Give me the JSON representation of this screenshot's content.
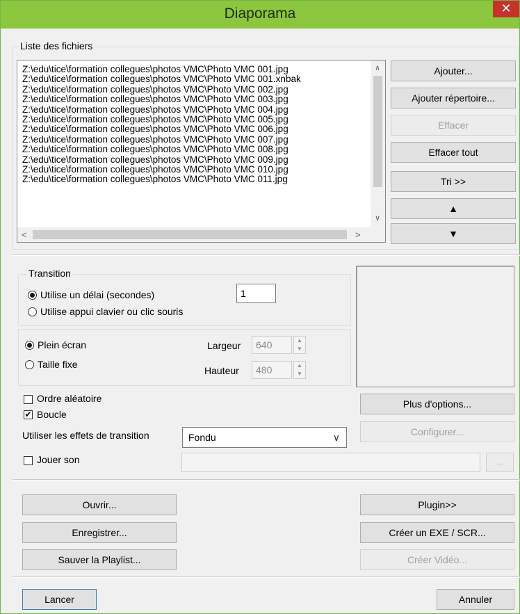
{
  "window": {
    "title": "Diaporama",
    "close_glyph": "✕"
  },
  "file_list": {
    "legend": "Liste des fichiers",
    "items": [
      "Z:\\edu\\tice\\formation collegues\\photos VMC\\Photo  VMC 001.jpg",
      "Z:\\edu\\tice\\formation collegues\\photos VMC\\Photo  VMC 001.xnbak",
      "Z:\\edu\\tice\\formation collegues\\photos VMC\\Photo  VMC 002.jpg",
      "Z:\\edu\\tice\\formation collegues\\photos VMC\\Photo  VMC 003.jpg",
      "Z:\\edu\\tice\\formation collegues\\photos VMC\\Photo  VMC 004.jpg",
      "Z:\\edu\\tice\\formation collegues\\photos VMC\\Photo  VMC 005.jpg",
      "Z:\\edu\\tice\\formation collegues\\photos VMC\\Photo  VMC 006.jpg",
      "Z:\\edu\\tice\\formation collegues\\photos VMC\\Photo  VMC 007.jpg",
      "Z:\\edu\\tice\\formation collegues\\photos VMC\\Photo  VMC 008.jpg",
      "Z:\\edu\\tice\\formation collegues\\photos VMC\\Photo  VMC 009.jpg",
      "Z:\\edu\\tice\\formation collegues\\photos VMC\\Photo  VMC 010.jpg",
      "Z:\\edu\\tice\\formation collegues\\photos VMC\\Photo  VMC 011.jpg"
    ],
    "buttons": {
      "add": "Ajouter...",
      "add_folder": "Ajouter répertoire...",
      "delete": "Effacer",
      "delete_all": "Effacer tout",
      "sort": "Tri >>",
      "up_glyph": "▲",
      "down_glyph": "▼"
    },
    "scroll": {
      "up": "∧",
      "down": "∨",
      "left": "<",
      "right": ">"
    }
  },
  "transition": {
    "legend": "Transition",
    "use_delay_label": "Utilise un délai (secondes)",
    "delay_value": "1",
    "use_keyboard_label": "Utilise appui clavier ou clic souris"
  },
  "display": {
    "fullscreen_label": "Plein écran",
    "fixed_size_label": "Taille fixe",
    "width_label": "Largeur",
    "width_value": "640",
    "height_label": "Hauteur",
    "height_value": "480",
    "spin_up": "▲",
    "spin_down": "▼"
  },
  "options": {
    "random_label": "Ordre aléatoire",
    "random_checked": false,
    "loop_label": "Boucle",
    "loop_checked": true,
    "check_glyph": "✔",
    "effects_label": "Utiliser les effets de transition",
    "effect_selected": "Fondu",
    "dropdown_glyph": "∨",
    "play_sound_label": "Jouer son",
    "play_sound_checked": false,
    "browse_label": "...",
    "more_options": "Plus d'options...",
    "configure": "Configurer..."
  },
  "actions": {
    "open": "Ouvrir...",
    "save": "Enregistrer...",
    "save_playlist": "Sauver la Playlist...",
    "plugin": "Plugin>>",
    "create_exe": "Créer un EXE / SCR...",
    "create_video": "Créer Vidéo..."
  },
  "footer": {
    "launch": "Lancer",
    "cancel": "Annuler"
  }
}
